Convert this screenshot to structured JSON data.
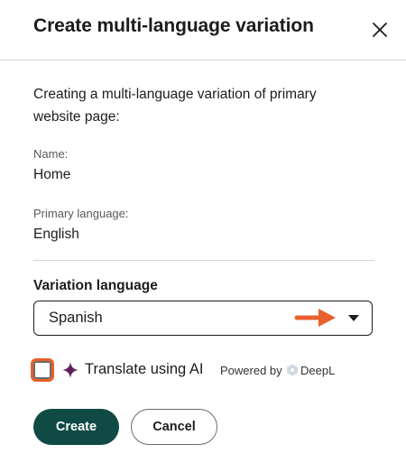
{
  "dialog": {
    "title": "Create multi-language variation",
    "close_icon": "close-icon"
  },
  "intro": {
    "text": "Creating a multi-language variation of primary website page:"
  },
  "fields": {
    "name_label": "Name:",
    "name_value": "Home",
    "primary_language_label": "Primary language:",
    "primary_language_value": "English"
  },
  "variation": {
    "label": "Variation language",
    "selected": "Spanish",
    "caret_icon": "caret-down-icon"
  },
  "translate": {
    "checked": false,
    "icon": "sparkle-icon",
    "label": "Translate using AI",
    "powered_by": "Powered by",
    "provider_icon": "deepl-logo-icon",
    "provider": "DeepL"
  },
  "actions": {
    "create_label": "Create",
    "cancel_label": "Cancel"
  },
  "colors": {
    "primary_button": "#0f4a45",
    "annotation": "#e8602c",
    "sparkle": "#5e1f5e",
    "divider": "#d6d6d6"
  }
}
